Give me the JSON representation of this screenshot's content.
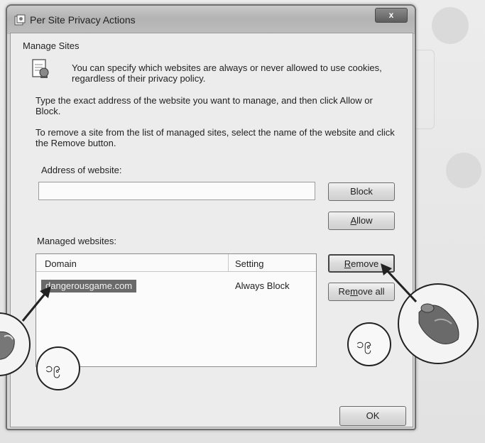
{
  "window": {
    "title": "Per Site Privacy Actions",
    "close_glyph": "x"
  },
  "manage": {
    "group_title": "Manage Sites",
    "info_text": "You can specify which websites are always or never allowed to use cookies, regardless of their privacy policy.",
    "instruction_1": "Type the exact address of the website you want to manage, and then click Allow or Block.",
    "instruction_2": "To remove a site from the list of managed sites, select the name of the website and click the Remove button.",
    "address_label": "Address of website:",
    "address_value": "",
    "managed_label": "Managed websites:"
  },
  "buttons": {
    "block": "Block",
    "allow": "Allow",
    "remove": "Remove",
    "remove_all": "Remove all",
    "ok": "OK"
  },
  "table": {
    "columns": [
      "Domain",
      "Setting"
    ],
    "rows": [
      {
        "domain": "dangerousgame.com",
        "setting": "Always Block"
      }
    ]
  },
  "annotations": {
    "label_left": "၁၉",
    "label_right": "၁၉"
  },
  "icons": {
    "title": "privacy-window-icon",
    "info": "document-info-icon",
    "hand_left": "pointing-hand-icon",
    "hand_right": "mouse-hand-icon"
  }
}
